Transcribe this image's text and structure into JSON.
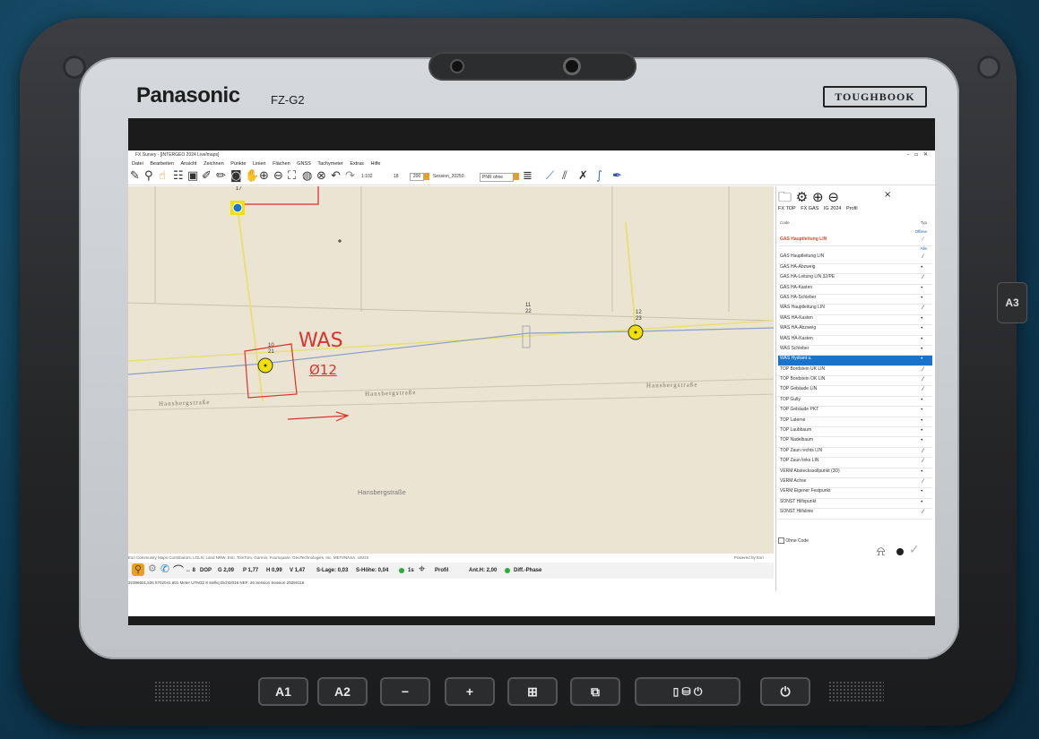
{
  "device": {
    "brand": "Panasonic",
    "model": "FZ-G2",
    "badge": "TOUGHBOOK",
    "side_key": "A3",
    "hw_buttons": [
      {
        "label": "A1"
      },
      {
        "label": "A2"
      },
      {
        "label": "−"
      },
      {
        "label": "+"
      },
      {
        "label": "⊞"
      },
      {
        "label": "⧉"
      },
      {
        "label": "▯  ⛁  ⏻"
      },
      {
        "label": "⏻"
      }
    ]
  },
  "app": {
    "title": "FX Survey - [INTERGEO 2024 Live/maps]",
    "menu": [
      "Datei",
      "Bearbeiten",
      "Ansicht",
      "Zeichnen",
      "Punkte",
      "Linien",
      "Flächen",
      "GNSS",
      "Tachymeter",
      "Extras",
      "Hilfe"
    ],
    "toolbar": {
      "scale": "1:102",
      "field1": "18",
      "field2": "200",
      "session": "Session_20250",
      "mode": "PNR ohne"
    },
    "map": {
      "labels": [
        {
          "text": "17"
        },
        {
          "text": "10"
        },
        {
          "text": "21"
        },
        {
          "text": "11"
        },
        {
          "text": "22"
        },
        {
          "text": "12"
        },
        {
          "text": "23"
        }
      ],
      "streets": [
        "Hansbergstraße",
        "Hansbergstraße",
        "Hansbergstraße",
        "Hansbergstraße"
      ],
      "handwriting": [
        "WAS",
        "Ø12"
      ]
    },
    "attribution": "Esri Community Maps Contributors, LGLN, Land NRW, Esri, TomTom, Garmin, Foursquare, GeoTechnologies, Inc, METI/NASA, USGS",
    "powered": "Powered by Esri",
    "status": {
      "sats": "8",
      "dop_label": "DOP",
      "g": "G 2,09",
      "p": "P 1,77",
      "h": "H 0,99",
      "v": "V 1,47",
      "slage": "S-Lage: 0,03",
      "shoehe": "S-Höhe: 0,04",
      "interval": "1s",
      "profil": "Profil",
      "anth": "Ant.H: 2,00",
      "phase": "Diff.-Phase"
    },
    "coords": "32396601,535 5702041,601 Meter  UTM32 8 stelliq  Dicht2016  NEF: 26     Session Session 20250116"
  },
  "panel": {
    "close": "×",
    "tabs": [
      "FX TOP",
      "FX GAS",
      "IG 2024",
      "Profil"
    ],
    "header_code": "Code",
    "header_type": "Typ",
    "offen": "Offene",
    "alle": "Alle",
    "highlight": {
      "label": "GAS Hauptleitung LIN",
      "sym": "⁄"
    },
    "rows": [
      {
        "label": "GAS Hauptleitung LIN",
        "sym": "⁄"
      },
      {
        "label": "GAS HA-Abzweig",
        "sym": "•"
      },
      {
        "label": "GAS HA-Leitung LIN 32/PE",
        "sym": "⁄"
      },
      {
        "label": "GAS HA-Kasten",
        "sym": "•"
      },
      {
        "label": "GAS HA-Schieber",
        "sym": "•"
      },
      {
        "label": "WAS Hauptleitung LIN",
        "sym": "⁄"
      },
      {
        "label": "WAS HA-Kasten",
        "sym": "•"
      },
      {
        "label": "WAS HA-Abzweig",
        "sym": "•"
      },
      {
        "label": "WAS HA-Kasten",
        "sym": "•"
      },
      {
        "label": "WAS Schieber",
        "sym": "•"
      },
      {
        "label": "WAS Hydrant u.",
        "sym": "•",
        "selected": true
      },
      {
        "label": "TOP Bordstein UK LIN",
        "sym": "⁄"
      },
      {
        "label": "TOP Bordstein OK LIN",
        "sym": "⁄"
      },
      {
        "label": "TOP Gebäude LIN",
        "sym": "⁄"
      },
      {
        "label": "TOP Gully",
        "sym": "•"
      },
      {
        "label": "TOP Gebäude PKT",
        "sym": "•"
      },
      {
        "label": "TOP Laterne",
        "sym": "•"
      },
      {
        "label": "TOP Laubbaum",
        "sym": "•"
      },
      {
        "label": "TOP Nadelbaum",
        "sym": "•"
      },
      {
        "label": "TOP Zaun rechts LIN",
        "sym": "⁄"
      },
      {
        "label": "TOP Zaun links LIN",
        "sym": "⁄"
      },
      {
        "label": "VERM Absteckssollpunkt (3D)",
        "sym": "•"
      },
      {
        "label": "VERM Achse",
        "sym": "⁄"
      },
      {
        "label": "VERM Eigener Festpunkt",
        "sym": "•"
      },
      {
        "label": "SONST Hilfspunkt",
        "sym": "•"
      },
      {
        "label": "SONST Hilfslinie",
        "sym": "⁄"
      }
    ],
    "ohne_code": "Ohne Code"
  }
}
